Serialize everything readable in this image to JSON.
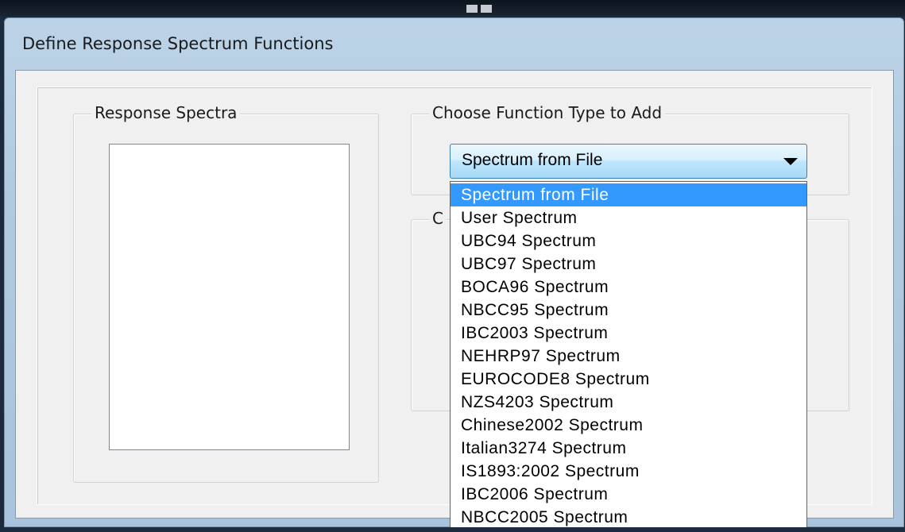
{
  "window": {
    "title": "Define Response Spectrum Functions"
  },
  "response_spectra": {
    "legend": "Response Spectra",
    "items": []
  },
  "choose_function": {
    "legend": "Choose  Function Type to Add",
    "selected_value": "Spectrum from File",
    "partial_legend_char": "C"
  },
  "dropdown": {
    "options": [
      "Spectrum from File",
      "User Spectrum",
      "UBC94 Spectrum",
      "UBC97 Spectrum",
      "BOCA96 Spectrum",
      "NBCC95 Spectrum",
      "IBC2003 Spectrum",
      "NEHRP97 Spectrum",
      "EUROCODE8 Spectrum",
      "NZS4203 Spectrum",
      "Chinese2002 Spectrum",
      "Italian3274 Spectrum",
      "IS1893:2002 Spectrum",
      "IBC2006 Spectrum",
      "NBCC2005 Spectrum"
    ],
    "highlighted_index": 0
  },
  "colors": {
    "selection": "#3399ff",
    "dialog_frame": "#b0c9df",
    "client_bg": "#f0f0f0"
  }
}
